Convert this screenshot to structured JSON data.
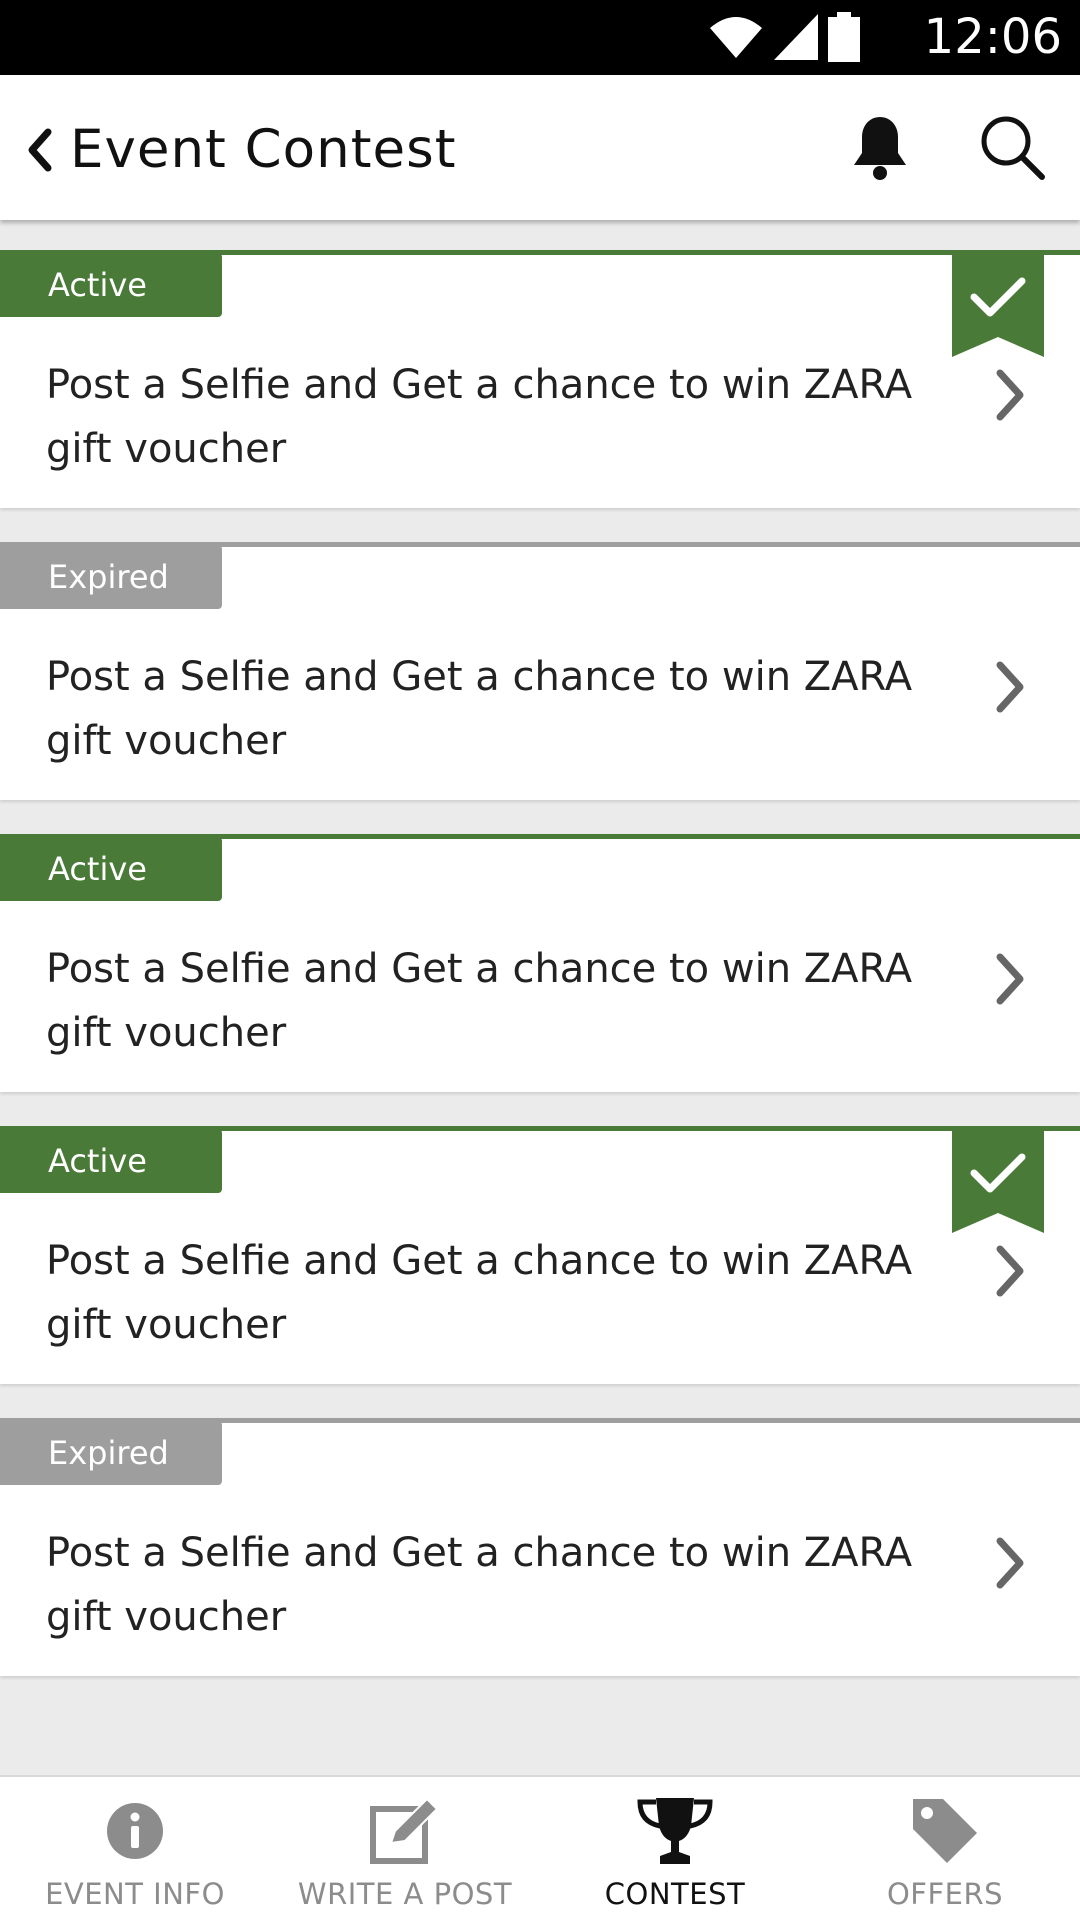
{
  "status_bar": {
    "time": "12:06"
  },
  "header": {
    "title": "Event Contest"
  },
  "contests": [
    {
      "status": "Active",
      "title": "Post a Selfie and Get a chance to win ZARA gift voucher",
      "participated": true
    },
    {
      "status": "Expired",
      "title": "Post a Selfie and Get a chance to win ZARA gift voucher",
      "participated": false
    },
    {
      "status": "Active",
      "title": "Post a Selfie and Get a chance to win ZARA gift voucher",
      "participated": false
    },
    {
      "status": "Active",
      "title": "Post a Selfie and Get a chance to win ZARA gift voucher",
      "participated": true
    },
    {
      "status": "Expired",
      "title": "Post a Selfie and Get a chance to win ZARA gift voucher",
      "participated": false
    }
  ],
  "bottom_nav": [
    {
      "label": "EVENT INFO",
      "icon": "info-icon",
      "active": false
    },
    {
      "label": "WRITE A POST",
      "icon": "edit-icon",
      "active": false
    },
    {
      "label": "CONTEST",
      "icon": "trophy-icon",
      "active": true
    },
    {
      "label": "OFFERS",
      "icon": "tag-icon",
      "active": false
    }
  ],
  "colors": {
    "active": "#4a7a38",
    "expired": "#9e9e9e",
    "background": "#ebebeb"
  }
}
